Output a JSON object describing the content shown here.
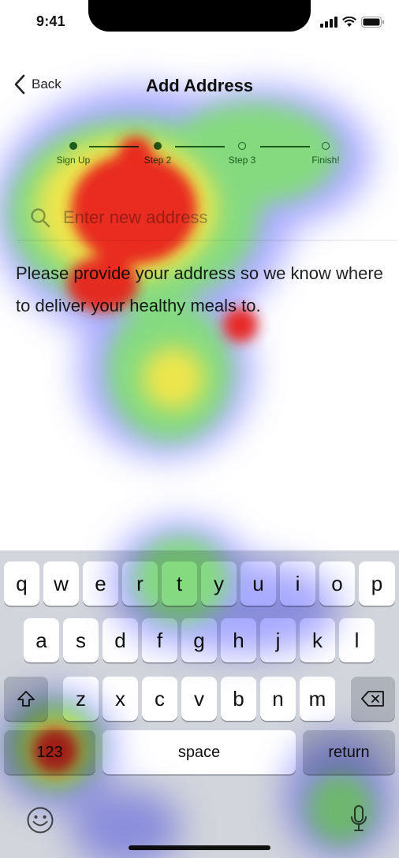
{
  "status_bar": {
    "time": "9:41"
  },
  "nav": {
    "back_label": "Back",
    "title": "Add Address"
  },
  "stepper": {
    "steps": [
      "Sign Up",
      "Step 2",
      "Step 3",
      "Finish!"
    ],
    "current_step": 2
  },
  "search": {
    "placeholder": "Enter new address"
  },
  "info_text": "Please provide your address so we know where to deliver your healthy meals to.",
  "keyboard": {
    "row1": [
      "q",
      "w",
      "e",
      "r",
      "t",
      "y",
      "u",
      "i",
      "o",
      "p"
    ],
    "row2": [
      "a",
      "s",
      "d",
      "f",
      "g",
      "h",
      "j",
      "k",
      "l"
    ],
    "row3": [
      "z",
      "x",
      "c",
      "v",
      "b",
      "n",
      "m"
    ],
    "numbers_label": "123",
    "space_label": "space",
    "return_label": "return"
  },
  "colors": {
    "accent": "#2e6b36",
    "keyboard_bg": "#d2d5db",
    "heat_hot": "#e8231c",
    "heat_warm": "#f3e64a",
    "heat_mid": "#7fe36b",
    "heat_cool": "#8a8cff"
  },
  "icons": [
    "signal-icon",
    "wifi-icon",
    "battery-icon",
    "back-chevron-icon",
    "search-icon",
    "shift-icon",
    "backspace-icon",
    "emoji-icon",
    "microphone-icon"
  ]
}
